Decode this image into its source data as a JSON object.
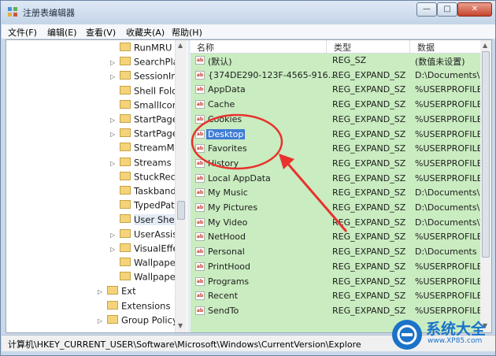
{
  "window": {
    "title": "注册表编辑器",
    "min_glyph": "—",
    "max_glyph": "□",
    "close_glyph": "✕"
  },
  "menu": [
    "文件(F)",
    "编辑(E)",
    "查看(V)",
    "收藏夹(A)",
    "帮助(H)"
  ],
  "tree": {
    "items": [
      {
        "label": "RunMRU",
        "expander": ""
      },
      {
        "label": "SearchPla",
        "expander": "▷"
      },
      {
        "label": "SessionIn",
        "expander": "▷"
      },
      {
        "label": "Shell Fold",
        "expander": ""
      },
      {
        "label": "SmallIcon",
        "expander": ""
      },
      {
        "label": "StartPage",
        "expander": "▷"
      },
      {
        "label": "StartPage",
        "expander": "▷"
      },
      {
        "label": "StreamMI",
        "expander": ""
      },
      {
        "label": "Streams",
        "expander": "▷"
      },
      {
        "label": "StuckRect",
        "expander": ""
      },
      {
        "label": "Taskband",
        "expander": ""
      },
      {
        "label": "TypedPatl",
        "expander": ""
      },
      {
        "label": "User Shel",
        "expander": "",
        "selected": true
      },
      {
        "label": "UserAssis",
        "expander": "▷"
      },
      {
        "label": "VisualEffe",
        "expander": "▷"
      },
      {
        "label": "Wallpape",
        "expander": ""
      },
      {
        "label": "Wallpape",
        "expander": ""
      },
      {
        "label": "Ext",
        "expander": "▷",
        "level": 1
      },
      {
        "label": "Extensions",
        "expander": "",
        "level": 1
      },
      {
        "label": "Group Policy",
        "expander": "▷",
        "level": 1
      }
    ]
  },
  "list": {
    "headers": {
      "name": "名称",
      "type": "类型",
      "data": "数据"
    },
    "rows": [
      {
        "name": "(默认)",
        "type": "REG_SZ",
        "data": "(数值未设置)"
      },
      {
        "name": "{374DE290-123F-4565-916...",
        "type": "REG_EXPAND_SZ",
        "data": "D:\\Documents\\D"
      },
      {
        "name": "AppData",
        "type": "REG_EXPAND_SZ",
        "data": "%USERPROFILE"
      },
      {
        "name": "Cache",
        "type": "REG_EXPAND_SZ",
        "data": "%USERPROFILE"
      },
      {
        "name": "Cookies",
        "type": "REG_EXPAND_SZ",
        "data": "%USERPROFILE"
      },
      {
        "name": "Desktop",
        "type": "REG_EXPAND_SZ",
        "data": "%USERPROFILE",
        "highlight": true
      },
      {
        "name": "Favorites",
        "type": "REG_EXPAND_SZ",
        "data": "%USERPROFILE"
      },
      {
        "name": "History",
        "type": "REG_EXPAND_SZ",
        "data": "%USERPROFILE"
      },
      {
        "name": "Local AppData",
        "type": "REG_EXPAND_SZ",
        "data": "%USERPROFILE"
      },
      {
        "name": "My Music",
        "type": "REG_EXPAND_SZ",
        "data": "D:\\Documents\\M"
      },
      {
        "name": "My Pictures",
        "type": "REG_EXPAND_SZ",
        "data": "D:\\Documents\\P"
      },
      {
        "name": "My Video",
        "type": "REG_EXPAND_SZ",
        "data": "D:\\Documents\\V"
      },
      {
        "name": "NetHood",
        "type": "REG_EXPAND_SZ",
        "data": "%USERPROFILE"
      },
      {
        "name": "Personal",
        "type": "REG_EXPAND_SZ",
        "data": "D:\\Documents"
      },
      {
        "name": "PrintHood",
        "type": "REG_EXPAND_SZ",
        "data": "%USERPROFILE"
      },
      {
        "name": "Programs",
        "type": "REG_EXPAND_SZ",
        "data": "%USERPROFILE"
      },
      {
        "name": "Recent",
        "type": "REG_EXPAND_SZ",
        "data": "%USERPROFILE"
      },
      {
        "name": "SendTo",
        "type": "REG_EXPAND_SZ",
        "data": "%USERPROFILE"
      }
    ]
  },
  "statusbar": {
    "path": "计算机\\HKEY_CURRENT_USER\\Software\\Microsoft\\Windows\\CurrentVersion\\Explore"
  },
  "watermark": {
    "title": "系统大全",
    "url": "www.XP85.com"
  },
  "colors": {
    "list_bg": "#c9ecc0",
    "highlight": "#3f7cd6",
    "annotation": "#e8322d"
  }
}
